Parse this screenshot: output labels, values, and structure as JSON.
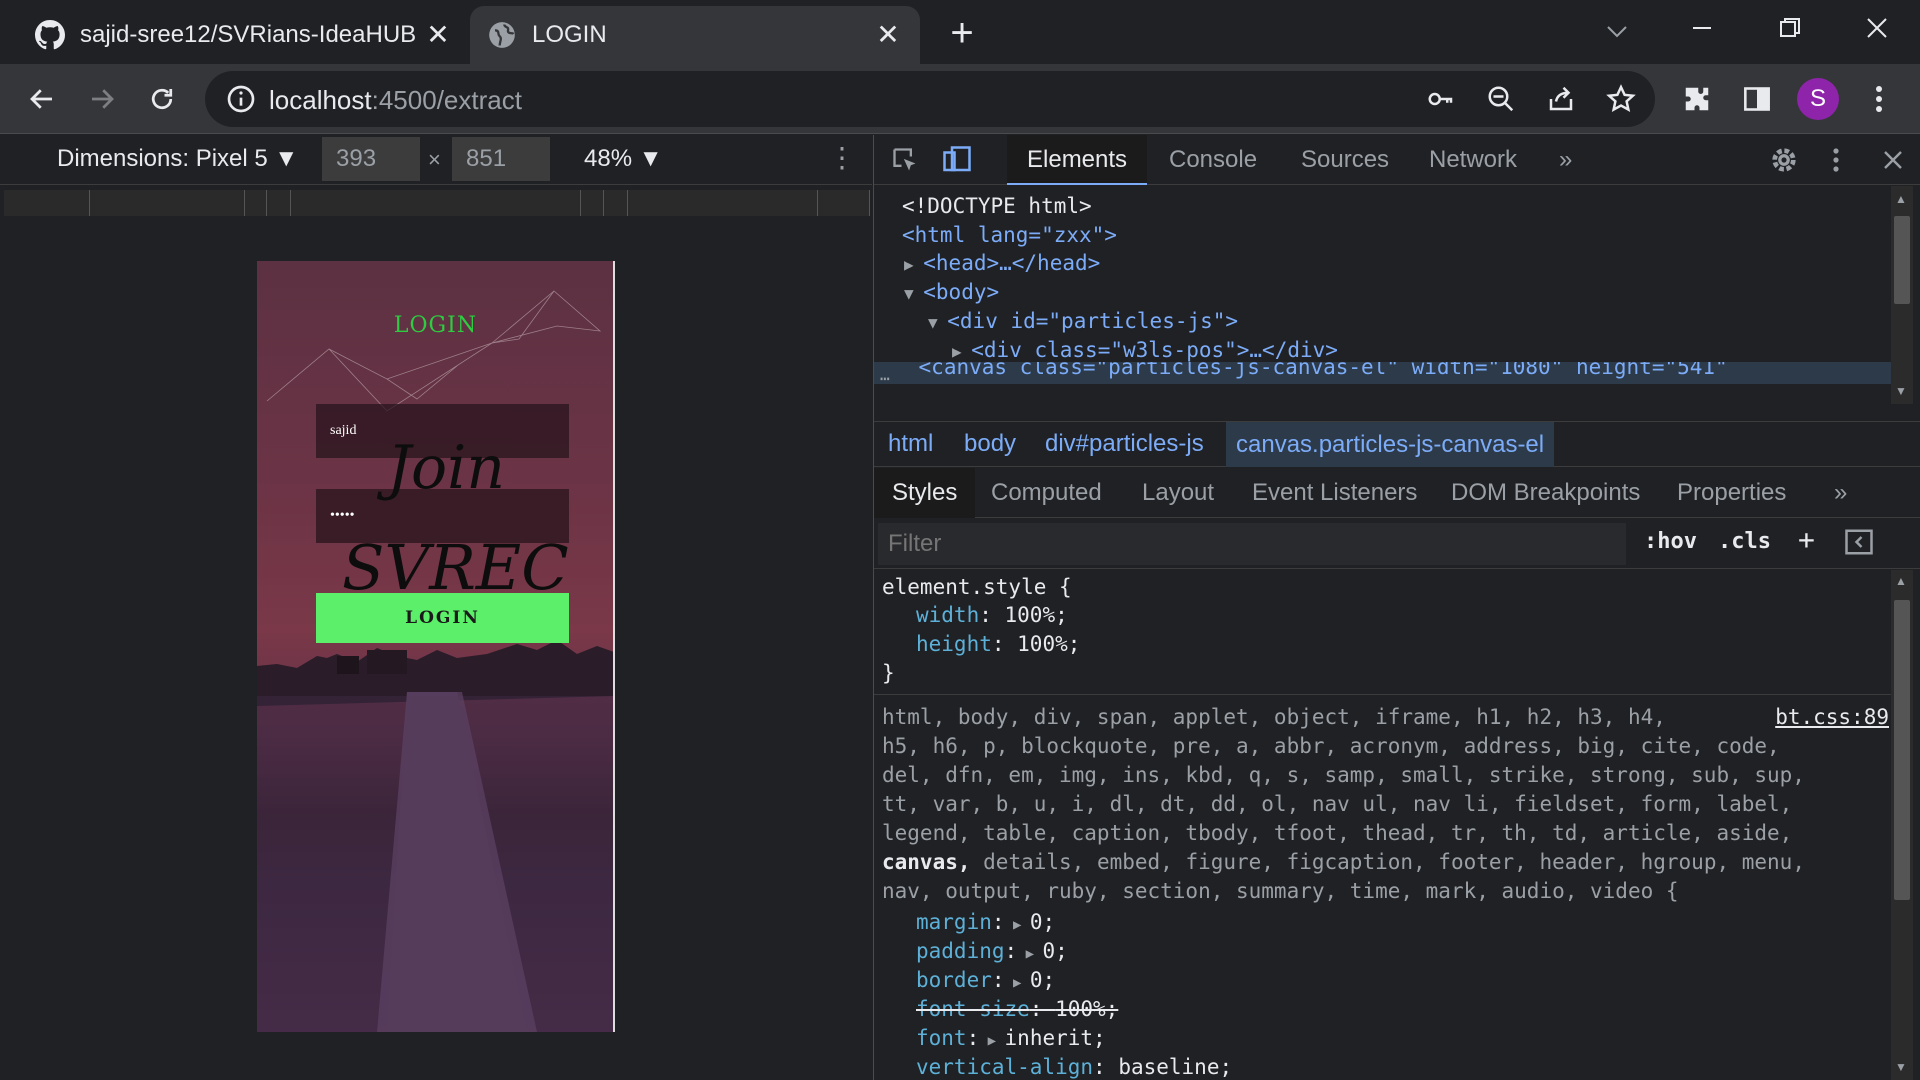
{
  "browser": {
    "tabs": [
      {
        "title": "sajid-sree12/SVRians-IdeaHUB",
        "favicon": "github-icon"
      },
      {
        "title": "LOGIN",
        "favicon": "globe-icon"
      }
    ],
    "url_host": "localhost",
    "url_rest": ":4500/extract",
    "avatar_letter": "S"
  },
  "device_toolbar": {
    "dimensions_label": "Dimensions: Pixel 5 ▼",
    "width": "393",
    "height": "851",
    "times": "×",
    "zoom": "48% ▼",
    "more": "⋮"
  },
  "page": {
    "title": "LOGIN",
    "username_value": "sajid",
    "password_value": "•••••",
    "login_button": "LOGIN",
    "overlay_word_1": "Join",
    "overlay_word_2": "SVREC"
  },
  "devtools": {
    "tabs": [
      "Elements",
      "Console",
      "Sources",
      "Network",
      "»"
    ],
    "dom": {
      "doctype": "<!DOCTYPE html>",
      "html_open": "<html lang=\"zxx\">",
      "head": "<head>…</head>",
      "body": "<body>",
      "div_particles": "<div id=\"particles-js\">",
      "div_w3ls": "<div class=\"w3ls-pos\">…</div>",
      "canvas": "<canvas class=\"particles-js-canvas-el\" width=\"1080\" height=\"541\""
    },
    "breadcrumbs": [
      "html",
      "body",
      "div#particles-js",
      "canvas.particles-js-canvas-el"
    ],
    "subtabs": [
      "Styles",
      "Computed",
      "Layout",
      "Event Listeners",
      "DOM Breakpoints",
      "Properties",
      "»"
    ],
    "filter_placeholder": "Filter",
    "hov": ":hov",
    "cls": ".cls",
    "plus": "+",
    "styles": {
      "element_style_selector": "element.style {",
      "width_prop": "width",
      "width_val": "100%;",
      "height_prop": "height",
      "height_val": "100%;",
      "close_brace": "}",
      "source": "bt.css:89",
      "reset_selector_lines": [
        "html, body, div, span, applet, object, iframe, h1, h2, h3, h4,",
        "h5, h6, p, blockquote, pre, a, abbr, acronym, address, big, cite, code,",
        "del, dfn, em, img, ins, kbd, q, s, samp, small, strike, strong, sub, sup,",
        "tt, var, b, u, i, dl, dt, dd, ol, nav ul, nav li, fieldset, form, label,",
        "legend, table, caption, tbody, tfoot, thead, tr, th, td, article, aside,"
      ],
      "canvas_word": "canvas,",
      "line6_rest": " details, embed, figure, figcaption, footer, header, hgroup, menu,",
      "line7": "nav, output, ruby, section, summary, time, mark, audio, video {",
      "decls": [
        {
          "prop": "margin",
          "val": "0;",
          "tri": true
        },
        {
          "prop": "padding",
          "val": "0;",
          "tri": true
        },
        {
          "prop": "border",
          "val": "0;",
          "tri": true
        },
        {
          "prop": "font-size",
          "val": "100%;",
          "strike": true
        },
        {
          "prop": "font",
          "val": "inherit;",
          "tri": true
        },
        {
          "prop": "vertical-align",
          "val": "baseline;"
        }
      ]
    }
  }
}
